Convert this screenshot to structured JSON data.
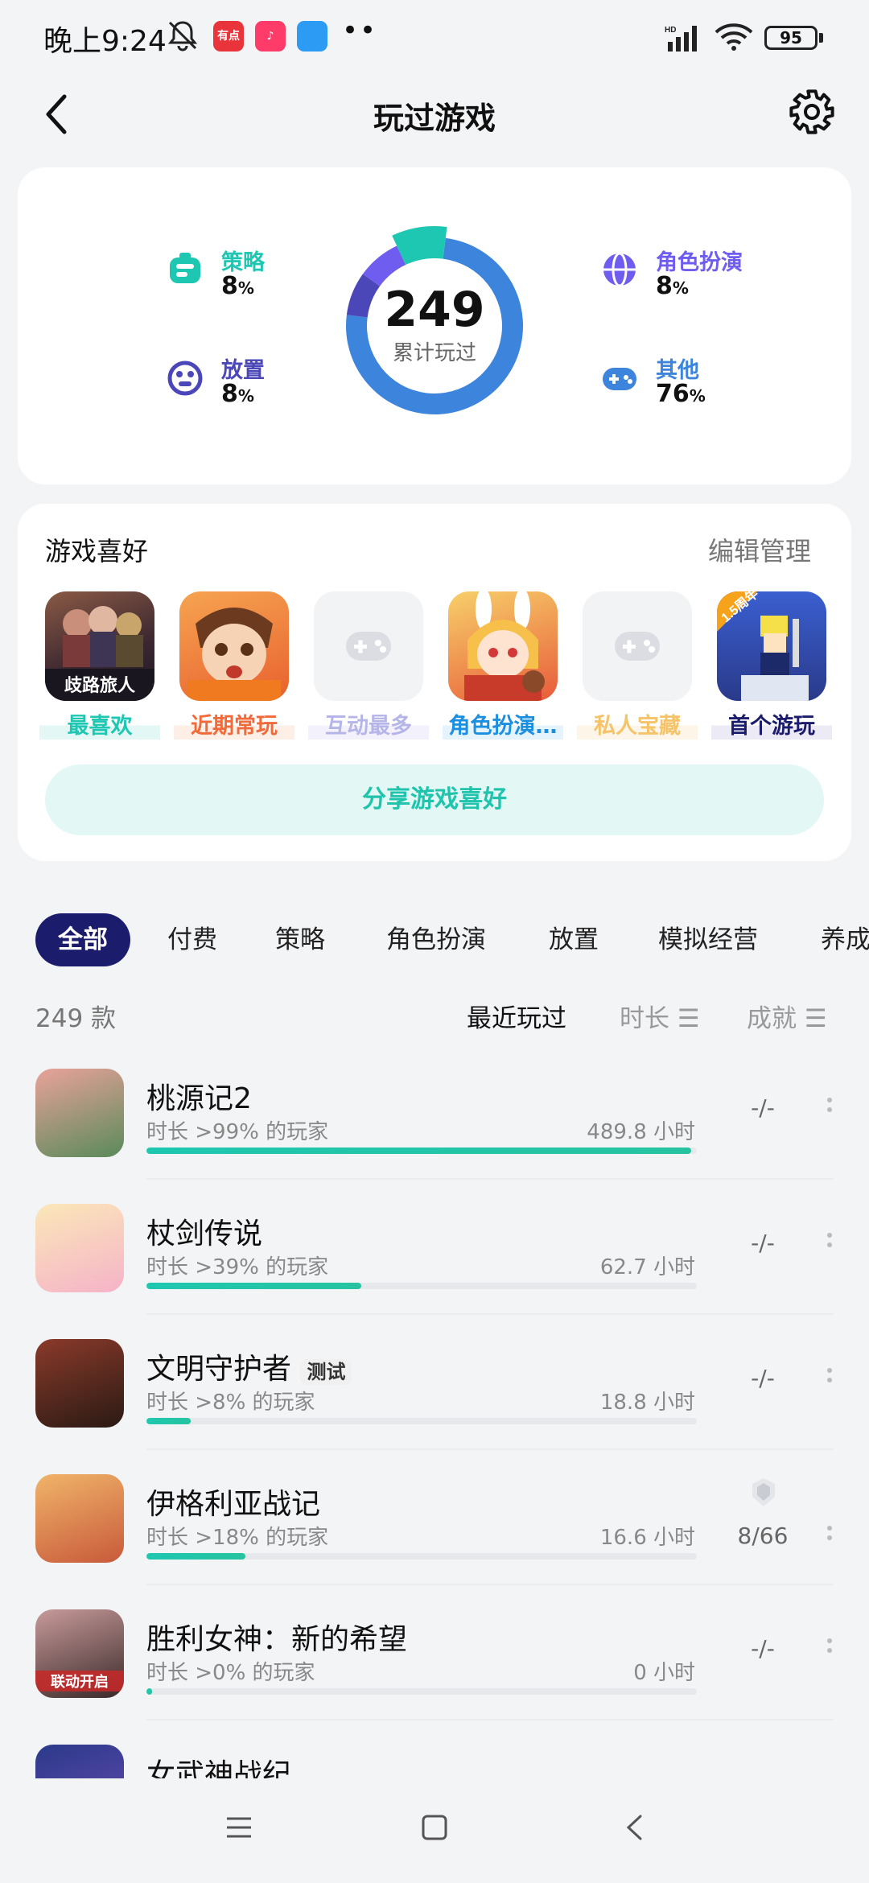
{
  "status": {
    "time": "晚上9:24",
    "battery": "95",
    "more": "••",
    "app_icons": [
      {
        "name": "news-app-icon",
        "color": "#e8343a",
        "text": "有点"
      },
      {
        "name": "tiktok-app-icon",
        "color": "#ff3b6a",
        "text": "♪"
      },
      {
        "name": "notes-app-icon",
        "color": "#2b9bf4",
        "text": ""
      }
    ]
  },
  "header": {
    "title": "玩过游戏"
  },
  "stats": {
    "total": "249",
    "total_label": "累计玩过",
    "categories": [
      {
        "name": "策略",
        "pct": "8",
        "color": "#1ec7b2"
      },
      {
        "name": "放置",
        "pct": "8",
        "color": "#4b47b8"
      },
      {
        "name": "角色扮演",
        "pct": "8",
        "color": "#6f5df0"
      },
      {
        "name": "其他",
        "pct": "76",
        "color": "#3c84dc"
      }
    ],
    "pct_sign": "%"
  },
  "prefs": {
    "title": "游戏喜好",
    "edit": "编辑管理",
    "items": [
      {
        "tag": "最喜欢",
        "color": "#1ec7b2",
        "bg": "#e3f7f5",
        "icon": "game-icon-qilu-lvren",
        "label": "歧路旅人"
      },
      {
        "tag": "近期常玩",
        "color": "#f06a3a",
        "bg": "#fdeee6",
        "icon": "game-icon-anime-character"
      },
      {
        "tag": "互动最多",
        "color": "#b6b5e8",
        "bg": "#f3f2fc",
        "icon": "gamepad-icon"
      },
      {
        "tag": "角色扮演…",
        "color": "#1b8fe0",
        "bg": "#e5f3fd",
        "icon": "game-icon-bunny-girl"
      },
      {
        "tag": "私人宝藏",
        "color": "#f5c46a",
        "bg": "#fdf6e8",
        "icon": "gamepad-icon"
      },
      {
        "tag": "首个游玩",
        "color": "#1c1c6d",
        "bg": "#eceaf5",
        "icon": "game-icon-pixel-knight",
        "label": "1.5周年"
      }
    ],
    "share": "分享游戏喜好"
  },
  "tabs": [
    "全部",
    "付费",
    "策略",
    "角色扮演",
    "放置",
    "模拟经营",
    "养成"
  ],
  "list_header": {
    "count": "249 款",
    "sort_recent": "最近玩过",
    "sort_time": "时长",
    "sort_achievement": "成就"
  },
  "games": [
    {
      "name": "桃源记2",
      "badge": "",
      "sub": "时长 >99% 的玩家",
      "hours": "489.8 小时",
      "progress": 0.99,
      "achievement": "-/-",
      "has_trophy": false,
      "icon": "game-icon-taoyuanji"
    },
    {
      "name": "杖剑传说",
      "badge": "",
      "sub": "时长 >39% 的玩家",
      "hours": "62.7 小时",
      "progress": 0.39,
      "achievement": "-/-",
      "has_trophy": false,
      "icon": "game-icon-zhangjian"
    },
    {
      "name": "文明守护者",
      "badge": "测试",
      "sub": "时长 >8% 的玩家",
      "hours": "18.8 小时",
      "progress": 0.08,
      "achievement": "-/-",
      "has_trophy": false,
      "icon": "game-icon-wenming"
    },
    {
      "name": "伊格利亚战记",
      "badge": "",
      "sub": "时长 >18% 的玩家",
      "hours": "16.6 小时",
      "progress": 0.18,
      "achievement": "8/66",
      "has_trophy": true,
      "icon": "game-icon-yigeliya"
    },
    {
      "name": "胜利女神：新的希望",
      "badge": "",
      "sub": "时长 >0% 的玩家",
      "hours": "0 小时",
      "progress": 0.01,
      "achievement": "-/-",
      "has_trophy": false,
      "icon": "game-icon-nikke",
      "icon_label": "联动开启"
    },
    {
      "name": "女武神战纪",
      "badge": "",
      "sub": "",
      "hours": "",
      "progress": 0,
      "achievement": "",
      "has_trophy": false,
      "icon": "game-icon-valkyrie"
    }
  ]
}
